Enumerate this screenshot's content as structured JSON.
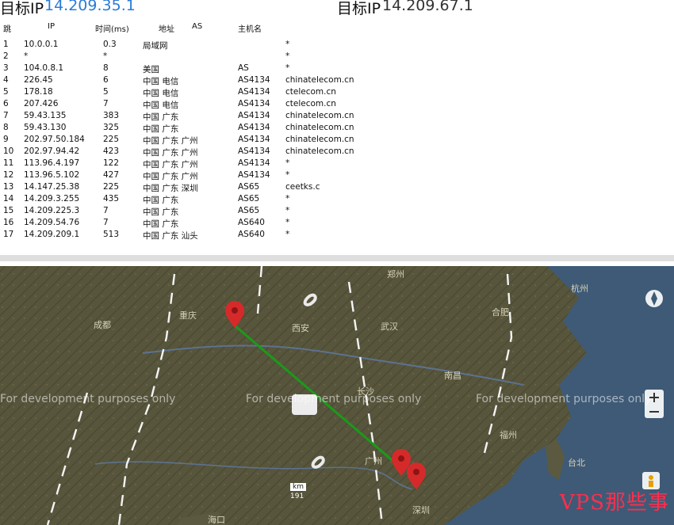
{
  "trace_panel": {
    "label_local": "目标IP",
    "target_ip": "14.209.35.1",
    "label_remote": "目标IP",
    "remote_ip": "14.209.67.1",
    "columns": [
      "跳",
      "IP",
      "时间(ms)",
      "地址",
      "AS",
      "主机名"
    ],
    "hops": [
      {
        "n": "1",
        "ip": "10.0.0.1",
        "ms": "0.3",
        "loc": "局域网",
        "as": "",
        "host": "*"
      },
      {
        "n": "2",
        "ip": "*",
        "ms": "*",
        "loc": "",
        "as": "",
        "host": "*"
      },
      {
        "n": "3",
        "ip": "104.0.8.1",
        "ms": "8",
        "loc": "美国",
        "as": "AS",
        "host": "*"
      },
      {
        "n": "4",
        "ip": "226.45",
        "ms": "6",
        "loc": "中国 电信",
        "as": "AS4134",
        "host": "chinatelecom.cn"
      },
      {
        "n": "5",
        "ip": "178.18",
        "ms": "5",
        "loc": "中国 电信",
        "as": "AS4134",
        "host": "ctelecom.cn"
      },
      {
        "n": "6",
        "ip": "207.426",
        "ms": "7",
        "loc": "中国 电信",
        "as": "AS4134",
        "host": "ctelecom.cn"
      },
      {
        "n": "7",
        "ip": "59.43.135",
        "ms": "383",
        "loc": "中国 广东",
        "as": "AS4134",
        "host": "chinatelecom.cn"
      },
      {
        "n": "8",
        "ip": "59.43.130",
        "ms": "325",
        "loc": "中国 广东",
        "as": "AS4134",
        "host": "chinatelecom.cn"
      },
      {
        "n": "9",
        "ip": "202.97.50.184",
        "ms": "225",
        "loc": "中国 广东 广州",
        "as": "AS4134",
        "host": "chinatelecom.cn"
      },
      {
        "n": "10",
        "ip": "202.97.94.42",
        "ms": "423",
        "loc": "中国 广东 广州",
        "as": "AS4134",
        "host": "chinatelecom.cn"
      },
      {
        "n": "11",
        "ip": "113.96.4.197",
        "ms": "122",
        "loc": "中国 广东 广州",
        "as": "AS4134",
        "host": "*"
      },
      {
        "n": "12",
        "ip": "113.96.5.102",
        "ms": "427",
        "loc": "中国 广东 广州",
        "as": "AS4134",
        "host": "*"
      },
      {
        "n": "13",
        "ip": "14.147.25.38",
        "ms": "225",
        "loc": "中国 广东 深圳",
        "as": "AS65",
        "host": "ceetks.c"
      },
      {
        "n": "14",
        "ip": "14.209.3.255",
        "ms": "435",
        "loc": "中国 广东",
        "as": "AS65",
        "host": "*"
      },
      {
        "n": "15",
        "ip": "14.209.225.3",
        "ms": "7",
        "loc": "中国 广东",
        "as": "AS65",
        "host": "*"
      },
      {
        "n": "16",
        "ip": "14.209.54.76",
        "ms": "7",
        "loc": "中国 广东",
        "as": "AS640",
        "host": "*"
      },
      {
        "n": "17",
        "ip": "14.209.209.1",
        "ms": "513",
        "loc": "中国 广东 汕头",
        "as": "AS640",
        "host": "*"
      }
    ]
  },
  "map": {
    "watermark": "For development purposes only",
    "scale_label": "km",
    "scale_value": "191",
    "brand": "VPS那些事",
    "cities": [
      "郑州",
      "西安",
      "武汉",
      "长沙",
      "南昌",
      "福州",
      "广州",
      "深圳",
      "重庆",
      "成都",
      "合肥",
      "杭州",
      "台北",
      "海口"
    ],
    "route_color": "#1a9a1a",
    "pin_color": "#d62a2a",
    "sea_color": "#3e5a76",
    "land_color": "#55533a"
  }
}
